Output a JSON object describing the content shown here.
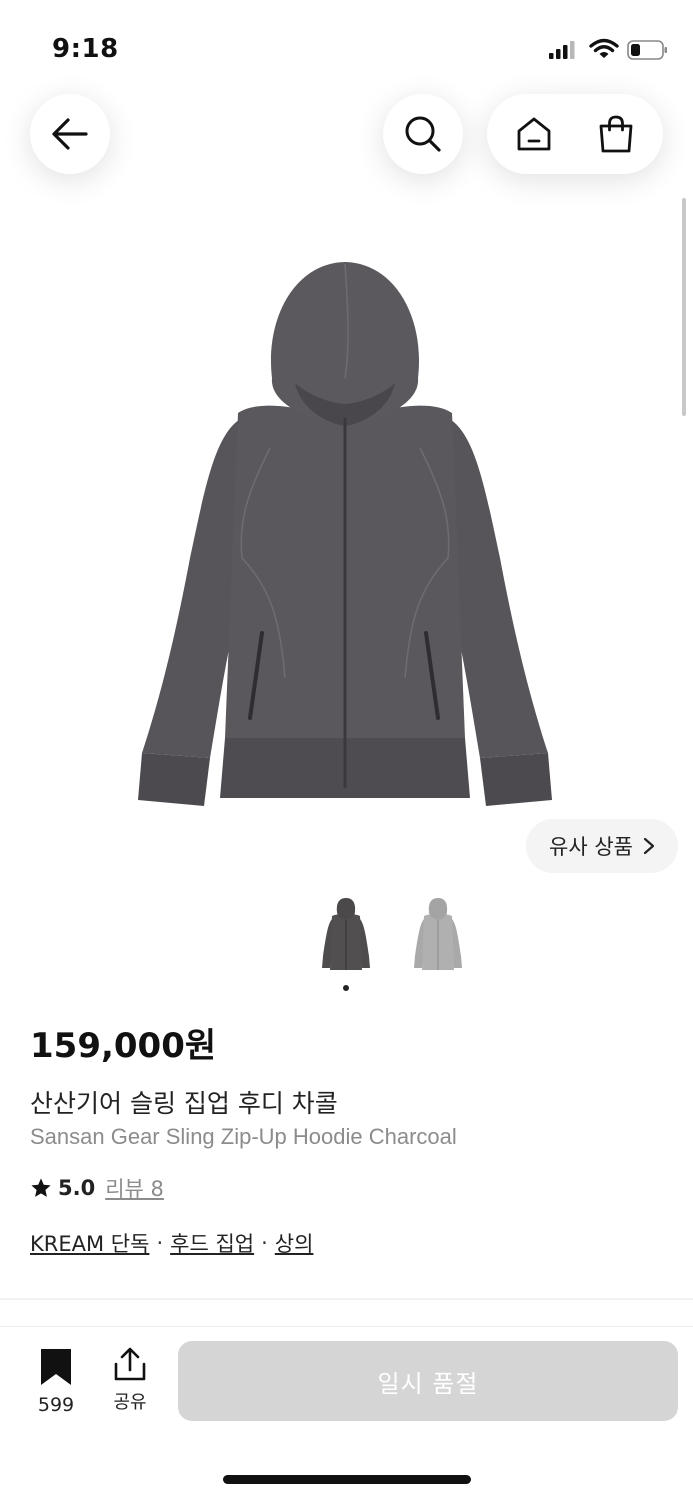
{
  "status_bar": {
    "time": "9:18"
  },
  "nav": {
    "back_icon": "arrow-left-icon",
    "search_icon": "search-icon",
    "home_icon": "home-icon",
    "cart_icon": "shopping-bag-icon"
  },
  "product": {
    "main_image": "charcoal-zip-up-hoodie",
    "similar_label": "유사 상품",
    "thumbnails": [
      {
        "name": "charcoal-hoodie-thumb",
        "color": "#4f4c4e"
      },
      {
        "name": "gray-hoodie-thumb",
        "color": "#a9a9a9"
      }
    ],
    "price": "159,000원",
    "title_ko": "산산기어 슬링 집업 후디 차콜",
    "title_en": "Sansan Gear Sling Zip-Up Hoodie Charcoal",
    "rating": "5.0",
    "review_label": "리뷰 8",
    "tags": [
      "KREAM 단독",
      "후드 집업",
      "상의"
    ],
    "tag_separator": "·"
  },
  "bottom_bar": {
    "bookmark_count": "599",
    "share_label": "공유",
    "buy_button_label": "일시 품절"
  },
  "colors": {
    "text": "#111111",
    "muted": "#8c8c8c",
    "button_disabled": "#d5d5d5",
    "hoodie": "#57545a"
  }
}
